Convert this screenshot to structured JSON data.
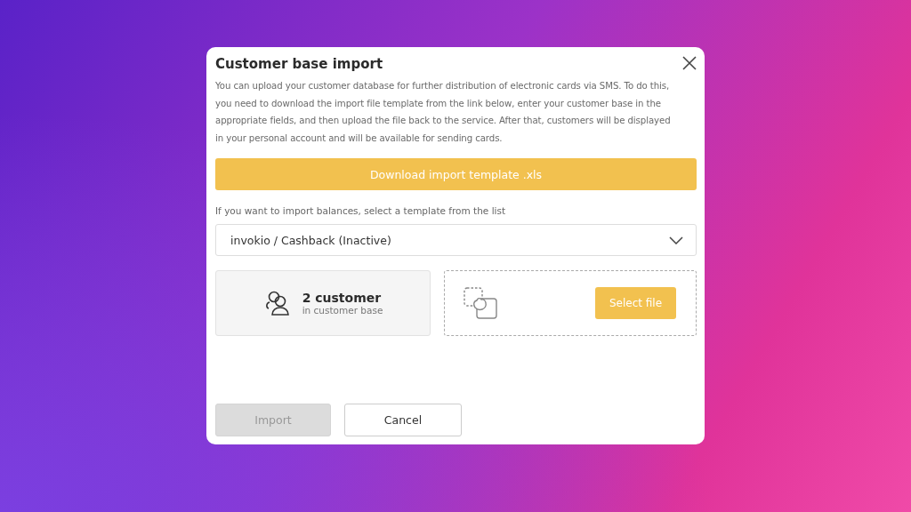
{
  "dialog": {
    "title": "Customer base import",
    "description": "You can upload your customer database for further distribution of electronic cards via SMS. To do this, you need to download the import file template from the link below, enter your customer base in the appropriate fields, and then upload the file back to the service. After that, customers will be displayed in your personal account and will be available for sending cards.",
    "download_button": "Download import template .xls",
    "template_hint": "If you want to import balances, select a template from the list",
    "template_select": {
      "value": "invokio / Cashback (Inactive)"
    },
    "customer_count": {
      "count": "2 customer",
      "caption": "in customer base"
    },
    "upload": {
      "button": "Select file"
    },
    "buttons": [
      {
        "label": "Import",
        "disabled": true
      },
      {
        "label": "Cancel",
        "disabled": false
      }
    ]
  }
}
